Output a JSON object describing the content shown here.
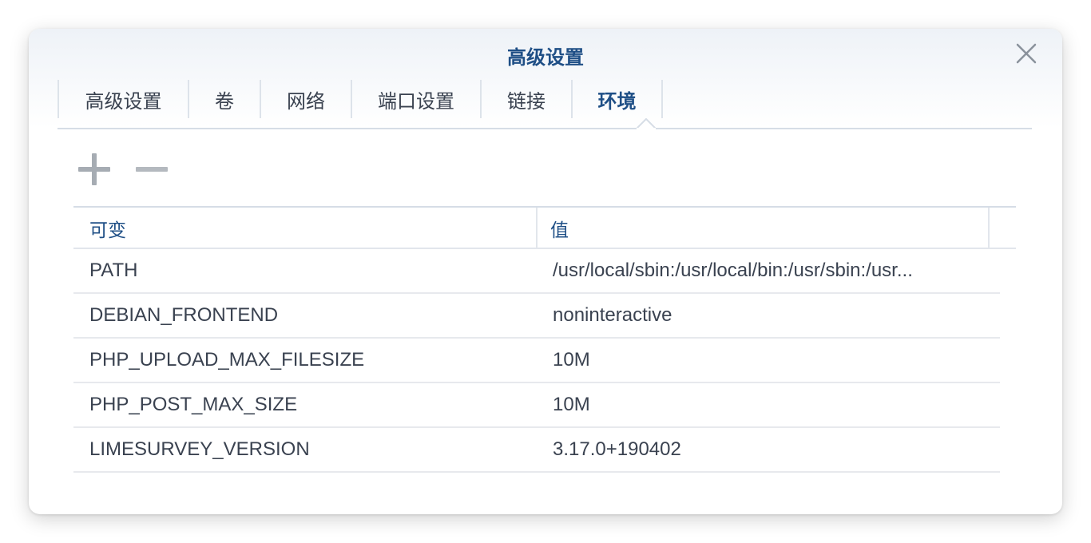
{
  "dialog": {
    "title": "高级设置"
  },
  "tabs": [
    {
      "label": "高级设置",
      "active": false
    },
    {
      "label": "卷",
      "active": false
    },
    {
      "label": "网络",
      "active": false
    },
    {
      "label": "端口设置",
      "active": false
    },
    {
      "label": "链接",
      "active": false
    },
    {
      "label": "环境",
      "active": true
    }
  ],
  "toolbar": {
    "add_icon": "plus-icon",
    "remove_icon": "minus-icon"
  },
  "table": {
    "columns": [
      "可变",
      "值"
    ],
    "rows": [
      {
        "name": "PATH",
        "value": "/usr/local/sbin:/usr/local/bin:/usr/sbin:/usr..."
      },
      {
        "name": "DEBIAN_FRONTEND",
        "value": "noninteractive"
      },
      {
        "name": "PHP_UPLOAD_MAX_FILESIZE",
        "value": "10M"
      },
      {
        "name": "PHP_POST_MAX_SIZE",
        "value": "10M"
      },
      {
        "name": "LIMESURVEY_VERSION",
        "value": "3.17.0+190402"
      }
    ]
  },
  "colors": {
    "accent": "#1f4f86",
    "text": "#3a4250",
    "border": "#d6dde6"
  }
}
